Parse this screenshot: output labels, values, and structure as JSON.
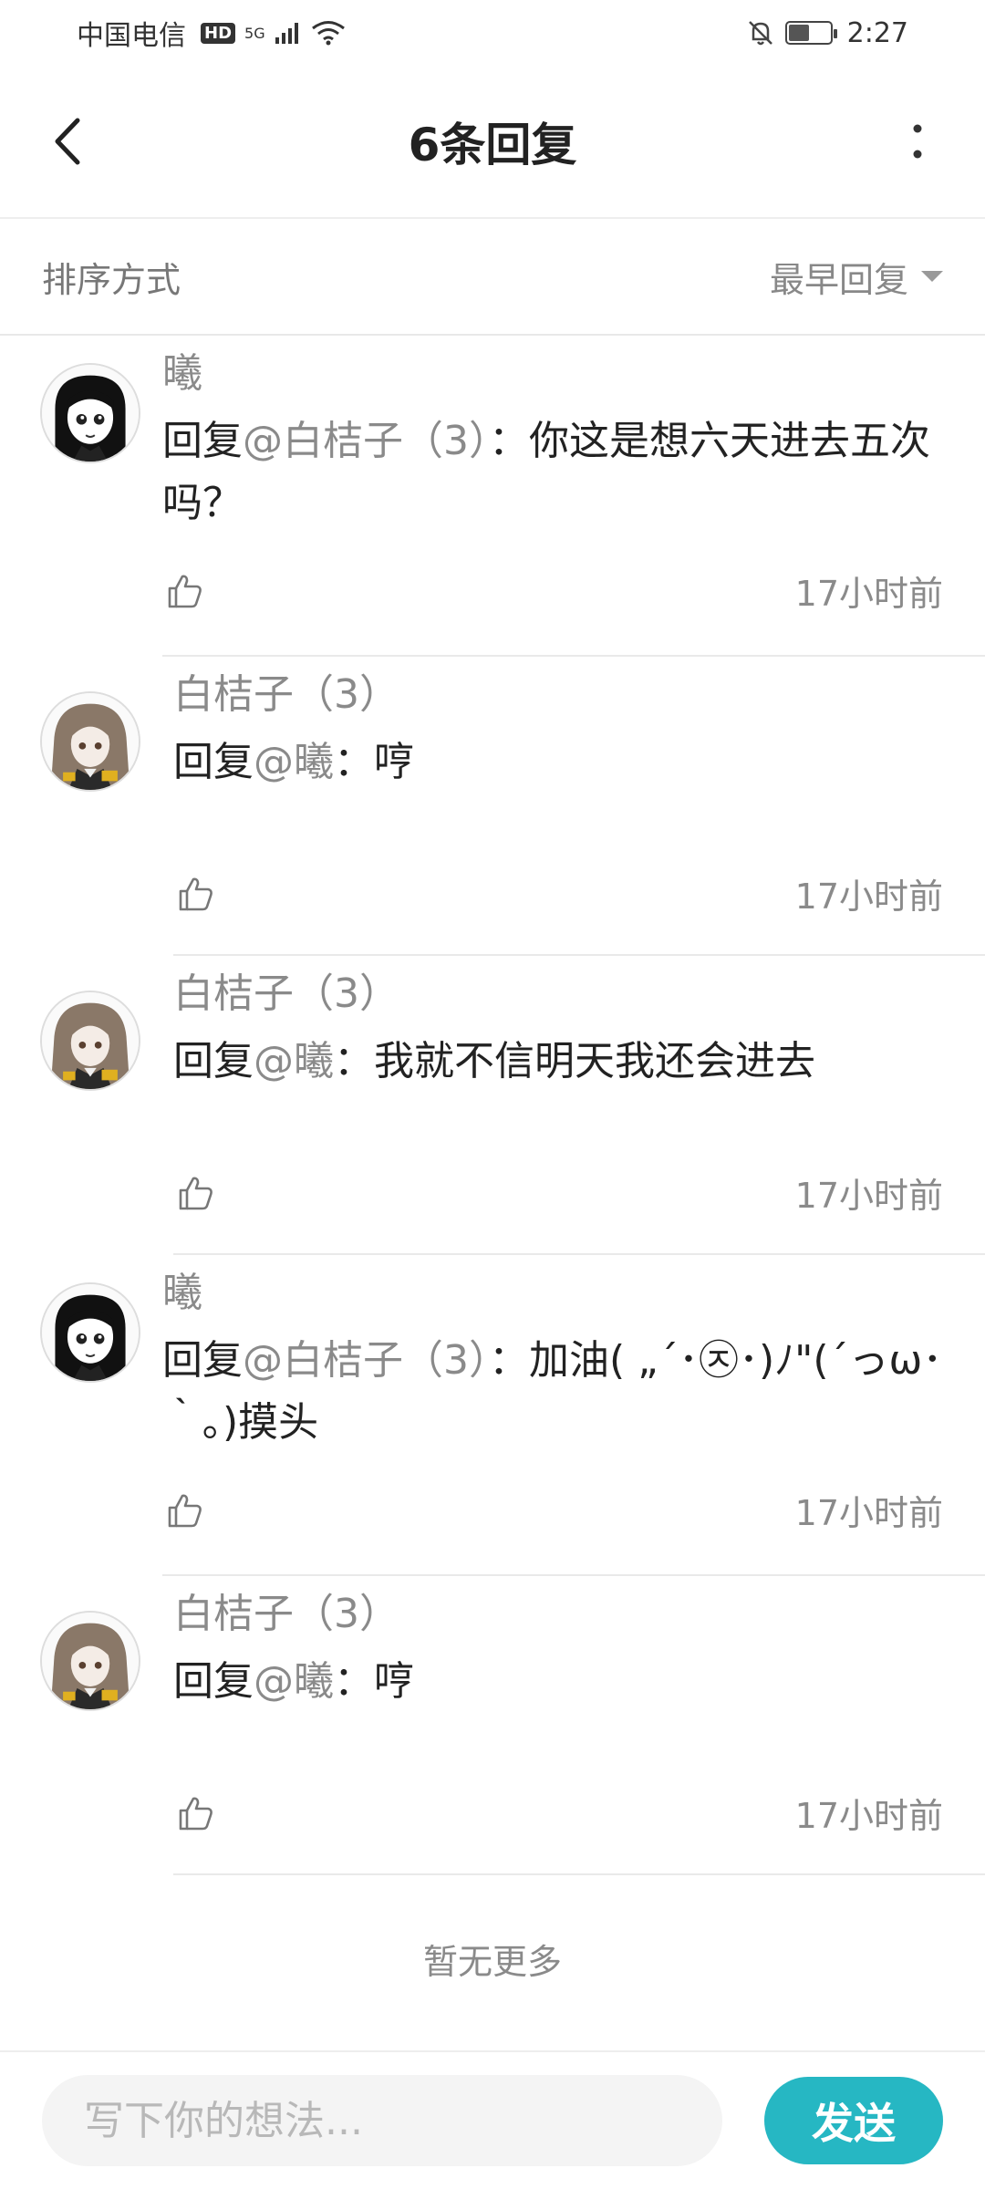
{
  "status_bar": {
    "carrier": "中国电信",
    "hd": "HD",
    "network": "5G",
    "time": "2:27",
    "battery_level": 0.5
  },
  "header": {
    "title": "6条回复",
    "back_icon": "chevron-left-icon",
    "more_icon": "more-vertical-icon"
  },
  "sort": {
    "label": "排序方式",
    "value": "最早回复"
  },
  "comments": [
    {
      "name": "曦",
      "reply_prefix": "回复",
      "mention": "@白桔子（3）",
      "separator": "：",
      "text": "你这是想六天进去五次吗？",
      "time": "17小时前",
      "avatar": "avatar-black-hair"
    },
    {
      "name": "白桔子（3）",
      "reply_prefix": "回复",
      "mention": "@曦",
      "separator": "：",
      "text": "哼",
      "time": "17小时前",
      "avatar": "avatar-brown-hair"
    },
    {
      "name": "白桔子（3）",
      "reply_prefix": "回复",
      "mention": "@曦",
      "separator": "：",
      "text": "我就不信明天我还会进去",
      "time": "17小时前",
      "avatar": "avatar-brown-hair"
    },
    {
      "name": "曦",
      "reply_prefix": "回复",
      "mention": "@白桔子（3）",
      "separator": "：",
      "text": "加油( „´･㉨･)ﾉ\"(´っω･｀｡)摸头",
      "time": "17小时前",
      "avatar": "avatar-black-hair"
    },
    {
      "name": "白桔子（3）",
      "reply_prefix": "回复",
      "mention": "@曦",
      "separator": "：",
      "text": "哼",
      "time": "17小时前",
      "avatar": "avatar-brown-hair"
    }
  ],
  "footer": {
    "no_more": "暂无更多"
  },
  "input": {
    "placeholder": "写下你的想法...",
    "value": "",
    "send_label": "发送"
  },
  "colors": {
    "accent": "#26b7c3",
    "muted_text": "#8a8a8a",
    "primary_text": "#222222"
  }
}
